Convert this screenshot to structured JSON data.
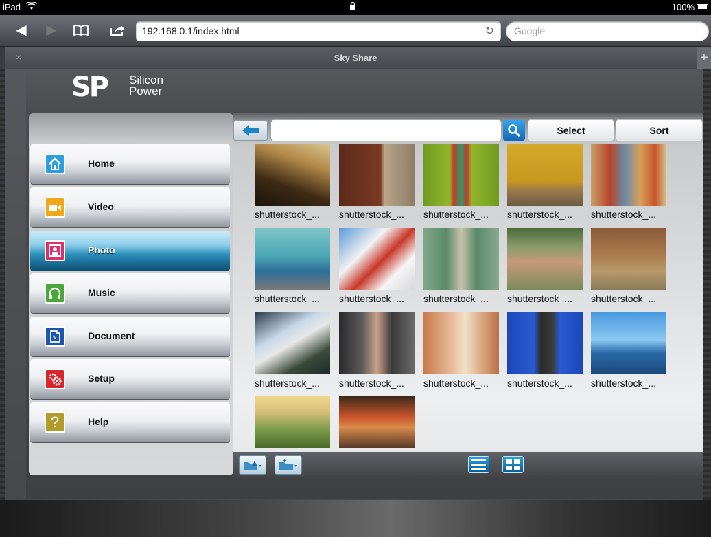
{
  "statusbar": {
    "device": "iPad",
    "battery": "100%"
  },
  "browser": {
    "url": "192.168.0.1/index.html",
    "search_placeholder": "Google",
    "tab_title": "Sky Share",
    "close_tab": "×",
    "new_tab": "+"
  },
  "brand": {
    "logo_mark": "SP",
    "name_line1": "Silicon",
    "name_line2": "Power"
  },
  "sidebar": {
    "items": [
      {
        "label": "Home",
        "icon": "home-icon",
        "color": "#2d9ee0"
      },
      {
        "label": "Video",
        "icon": "video-icon",
        "color": "#f0a81a"
      },
      {
        "label": "Photo",
        "icon": "photo-icon",
        "color": "#e0306b",
        "active": true
      },
      {
        "label": "Music",
        "icon": "music-icon",
        "color": "#49a83a"
      },
      {
        "label": "Document",
        "icon": "document-icon",
        "color": "#1e55b0"
      },
      {
        "label": "Setup",
        "icon": "settings-icon",
        "color": "#d8262b"
      },
      {
        "label": "Help",
        "icon": "help-icon",
        "color": "#b39b2a"
      }
    ]
  },
  "toolbar": {
    "select_label": "Select",
    "sort_label": "Sort",
    "path_value": ""
  },
  "photos": [
    {
      "caption": "shutterstock_..."
    },
    {
      "caption": "shutterstock_..."
    },
    {
      "caption": "shutterstock_..."
    },
    {
      "caption": "shutterstock_..."
    },
    {
      "caption": "shutterstock_..."
    },
    {
      "caption": "shutterstock_..."
    },
    {
      "caption": "shutterstock_..."
    },
    {
      "caption": "shutterstock_..."
    },
    {
      "caption": "shutterstock_..."
    },
    {
      "caption": "shutterstock_..."
    },
    {
      "caption": "shutterstock_..."
    },
    {
      "caption": "shutterstock_..."
    },
    {
      "caption": "shutterstock_..."
    },
    {
      "caption": "shutterstock_..."
    },
    {
      "caption": "shutterstock_..."
    },
    {
      "caption": ""
    },
    {
      "caption": ""
    }
  ],
  "colors": {
    "accent": "#1a86c8",
    "active_nav": "#0c4f72"
  }
}
